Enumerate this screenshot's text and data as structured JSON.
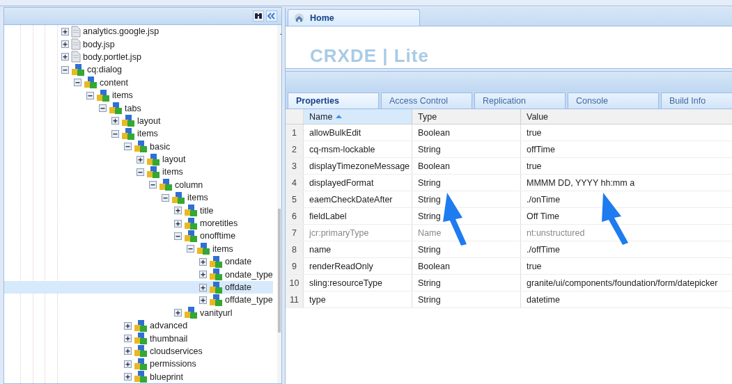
{
  "tree": {
    "items": [
      {
        "label": "analytics.google.jsp",
        "kind": "file",
        "expanded": false,
        "selected": false
      },
      {
        "label": "body.jsp",
        "kind": "file",
        "expanded": false,
        "selected": false
      },
      {
        "label": "body.portlet.jsp",
        "kind": "file",
        "expanded": false,
        "selected": false
      },
      {
        "label": "cq:dialog",
        "kind": "node",
        "expanded": true,
        "selected": false,
        "children": [
          {
            "label": "content",
            "kind": "node",
            "expanded": true,
            "selected": false,
            "children": [
              {
                "label": "items",
                "kind": "node",
                "expanded": true,
                "selected": false,
                "children": [
                  {
                    "label": "tabs",
                    "kind": "node",
                    "expanded": true,
                    "selected": false,
                    "children": [
                      {
                        "label": "layout",
                        "kind": "node",
                        "expanded": false,
                        "selected": false
                      },
                      {
                        "label": "items",
                        "kind": "node",
                        "expanded": true,
                        "selected": false,
                        "children": [
                          {
                            "label": "basic",
                            "kind": "node",
                            "expanded": true,
                            "selected": false,
                            "children": [
                              {
                                "label": "layout",
                                "kind": "node",
                                "expanded": false,
                                "selected": false
                              },
                              {
                                "label": "items",
                                "kind": "node",
                                "expanded": true,
                                "selected": false,
                                "children": [
                                  {
                                    "label": "column",
                                    "kind": "node",
                                    "expanded": true,
                                    "selected": false,
                                    "children": [
                                      {
                                        "label": "items",
                                        "kind": "node",
                                        "expanded": true,
                                        "selected": false,
                                        "children": [
                                          {
                                            "label": "title",
                                            "kind": "node",
                                            "expanded": false,
                                            "selected": false
                                          },
                                          {
                                            "label": "moretitles",
                                            "kind": "node",
                                            "expanded": false,
                                            "selected": false
                                          },
                                          {
                                            "label": "onofftime",
                                            "kind": "node",
                                            "expanded": true,
                                            "selected": false,
                                            "children": [
                                              {
                                                "label": "items",
                                                "kind": "node",
                                                "expanded": true,
                                                "selected": false,
                                                "children": [
                                                  {
                                                    "label": "ondate",
                                                    "kind": "node",
                                                    "expanded": false,
                                                    "selected": false
                                                  },
                                                  {
                                                    "label": "ondate_type",
                                                    "kind": "node",
                                                    "expanded": false,
                                                    "selected": false
                                                  },
                                                  {
                                                    "label": "offdate",
                                                    "kind": "node",
                                                    "expanded": false,
                                                    "selected": true
                                                  },
                                                  {
                                                    "label": "offdate_type",
                                                    "kind": "node",
                                                    "expanded": false,
                                                    "selected": false
                                                  }
                                                ]
                                              }
                                            ]
                                          },
                                          {
                                            "label": "vanityurl",
                                            "kind": "node",
                                            "expanded": false,
                                            "selected": false
                                          }
                                        ]
                                      }
                                    ]
                                  }
                                ]
                              }
                            ]
                          },
                          {
                            "label": "advanced",
                            "kind": "node",
                            "expanded": false,
                            "selected": false
                          },
                          {
                            "label": "thumbnail",
                            "kind": "node",
                            "expanded": false,
                            "selected": false
                          },
                          {
                            "label": "cloudservices",
                            "kind": "node",
                            "expanded": false,
                            "selected": false
                          },
                          {
                            "label": "permissions",
                            "kind": "node",
                            "expanded": false,
                            "selected": false
                          },
                          {
                            "label": "blueprint",
                            "kind": "node",
                            "expanded": false,
                            "selected": false
                          }
                        ]
                      }
                    ]
                  }
                ]
              }
            ]
          }
        ]
      }
    ]
  },
  "editor": {
    "tab": "Home",
    "logo": "CRXDE | Lite"
  },
  "tabs": [
    {
      "label": "Properties",
      "selected": true
    },
    {
      "label": "Access Control",
      "selected": false
    },
    {
      "label": "Replication",
      "selected": false
    },
    {
      "label": "Console",
      "selected": false
    },
    {
      "label": "Build Info",
      "selected": false
    }
  ],
  "table": {
    "columns": [
      {
        "label": "Name",
        "sorted": true
      },
      {
        "label": "Type",
        "sorted": false
      },
      {
        "label": "Value",
        "sorted": false
      }
    ],
    "rows": [
      {
        "index": "1",
        "name": "allowBulkEdit",
        "type": "Boolean",
        "value": "true",
        "disabled": false
      },
      {
        "index": "2",
        "name": "cq-msm-lockable",
        "type": "String",
        "value": "offTime",
        "disabled": false
      },
      {
        "index": "3",
        "name": "displayTimezoneMessage",
        "type": "Boolean",
        "value": "true",
        "disabled": false
      },
      {
        "index": "4",
        "name": "displayedFormat",
        "type": "String",
        "value": "MMMM DD, YYYY hh:mm a",
        "disabled": false
      },
      {
        "index": "5",
        "name": "eaemCheckDateAfter",
        "type": "String",
        "value": "./onTime",
        "disabled": false
      },
      {
        "index": "6",
        "name": "fieldLabel",
        "type": "String",
        "value": "Off Time",
        "disabled": false
      },
      {
        "index": "7",
        "name": "jcr:primaryType",
        "type": "Name",
        "value": "nt:unstructured",
        "disabled": true
      },
      {
        "index": "8",
        "name": "name",
        "type": "String",
        "value": "./offTime",
        "disabled": false
      },
      {
        "index": "9",
        "name": "renderReadOnly",
        "type": "Boolean",
        "value": "true",
        "disabled": false
      },
      {
        "index": "10",
        "name": "sling:resourceType",
        "type": "String",
        "value": "granite/ui/components/foundation/form/datepicker",
        "disabled": false
      },
      {
        "index": "11",
        "name": "type",
        "type": "String",
        "value": "datetime",
        "disabled": false
      }
    ]
  }
}
